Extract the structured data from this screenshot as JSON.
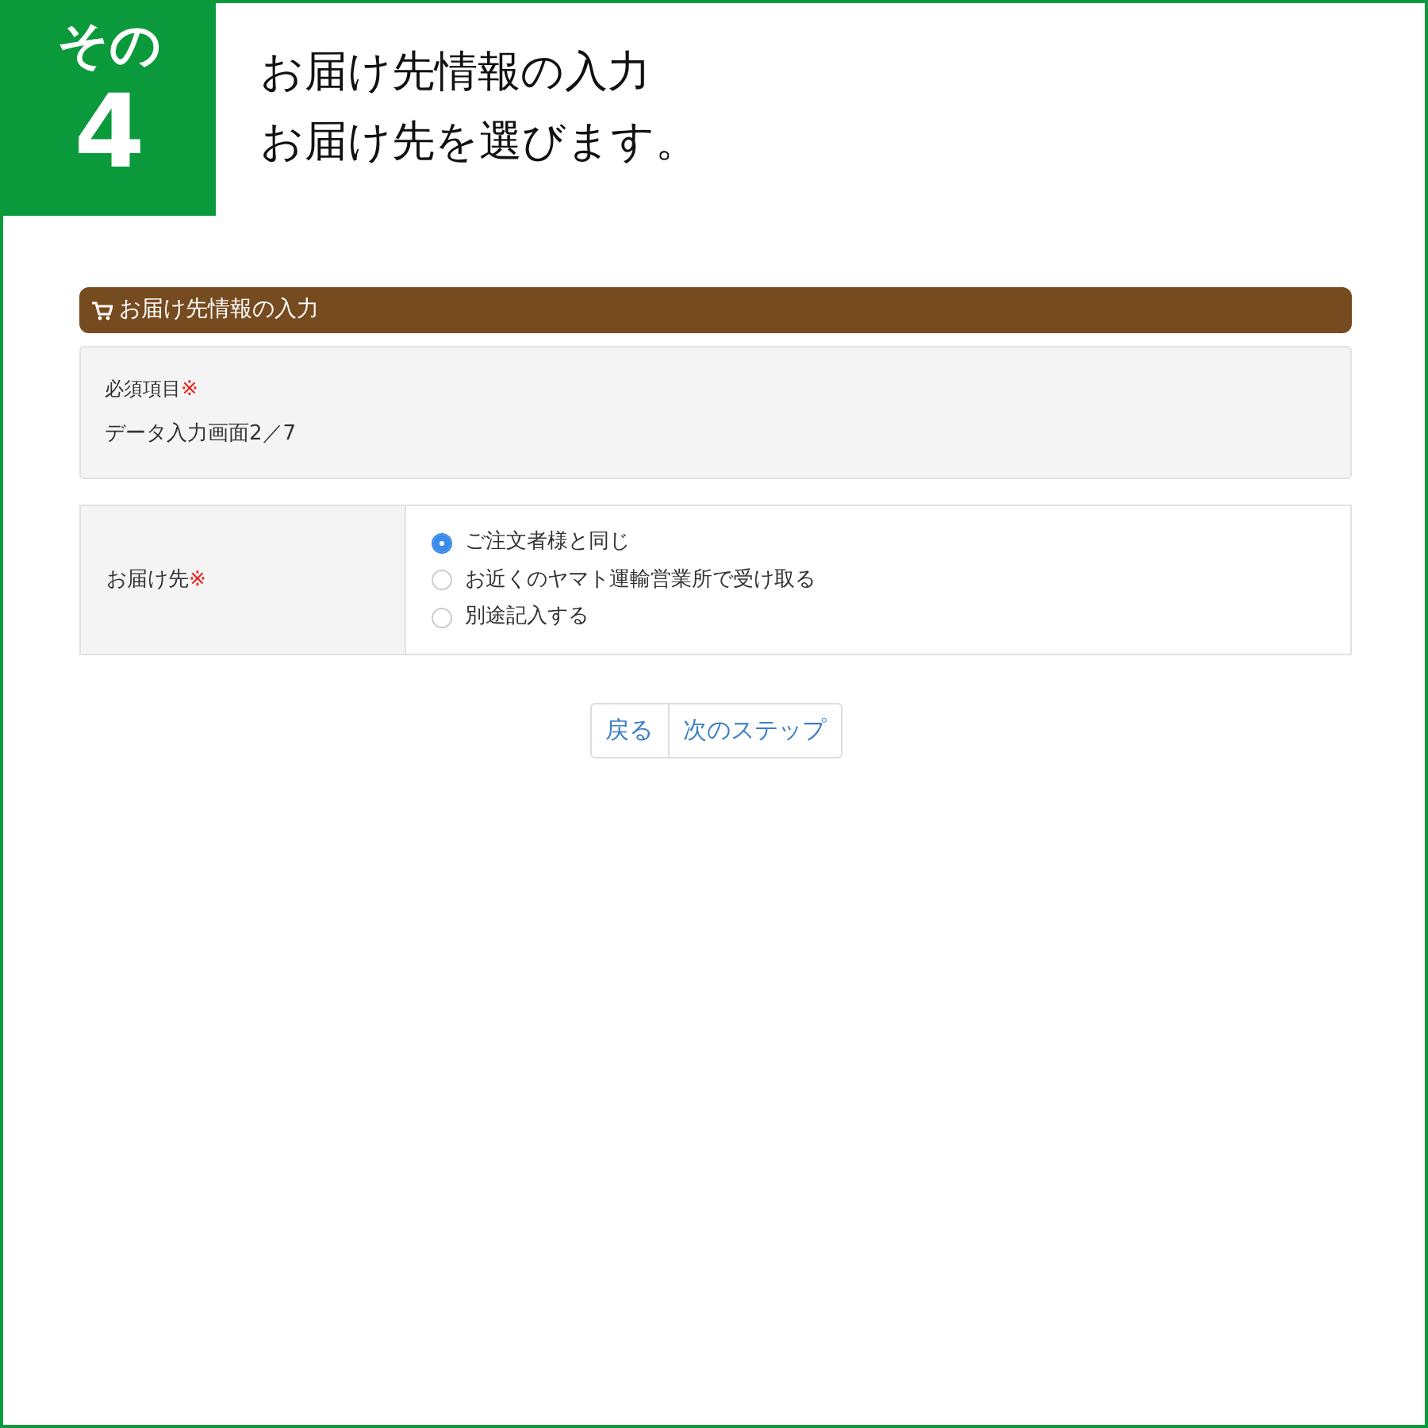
{
  "step_badge": {
    "label": "その",
    "number": "4"
  },
  "heading": {
    "lines": [
      "お届け先情報の入力",
      "お届け先を選びます。"
    ]
  },
  "panel": {
    "title": "お届け先情報の入力"
  },
  "info": {
    "required_label": "必須項目",
    "required_mark": "※",
    "screen_counter": "データ入力画面2／7"
  },
  "form": {
    "label": "お届け先",
    "required_mark": "※",
    "options": [
      {
        "label": "ご注文者様と同じ",
        "selected": true
      },
      {
        "label": "お近くのヤマト運輸営業所で受け取る",
        "selected": false
      },
      {
        "label": "別途記入する",
        "selected": false
      }
    ]
  },
  "buttons": [
    {
      "label": "戻る"
    },
    {
      "label": "次のステップ"
    }
  ]
}
